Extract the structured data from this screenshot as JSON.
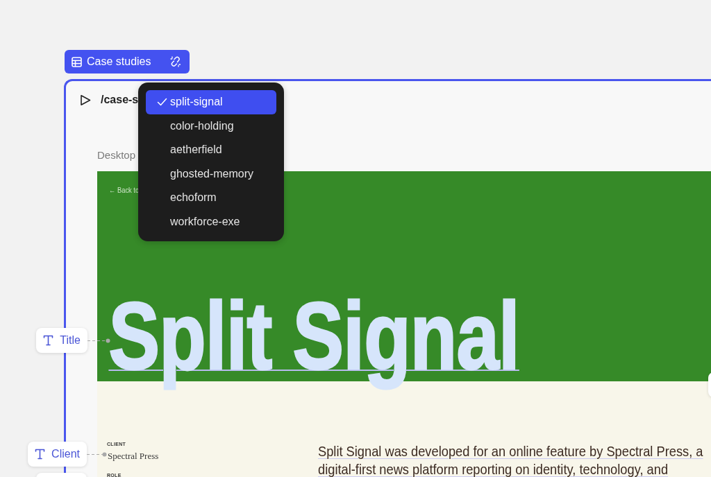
{
  "collection_tag": {
    "label": "Case studies"
  },
  "preview": {
    "path": "/case-s",
    "viewport": "Desktop",
    "page": {
      "back_link": "← Back to",
      "title": "Split Signal",
      "details": [
        {
          "label": "CLIENT",
          "value": "Spectral Press"
        },
        {
          "label": "ROLE"
        }
      ],
      "intro_lines": [
        "Split Signal was developed for an online feature by Spectral Press, a",
        "digital-first news platform reporting on identity, technology, and"
      ]
    }
  },
  "field_tags": [
    {
      "label": "Title"
    },
    {
      "label": "Client"
    }
  ],
  "slug_menu": {
    "items": [
      {
        "label": "split-signal",
        "selected": true
      },
      {
        "label": "color-holding",
        "selected": false
      },
      {
        "label": "aetherfield",
        "selected": false
      },
      {
        "label": "ghosted-memory",
        "selected": false
      },
      {
        "label": "echoform",
        "selected": false
      },
      {
        "label": "workforce-exe",
        "selected": false
      }
    ]
  }
}
